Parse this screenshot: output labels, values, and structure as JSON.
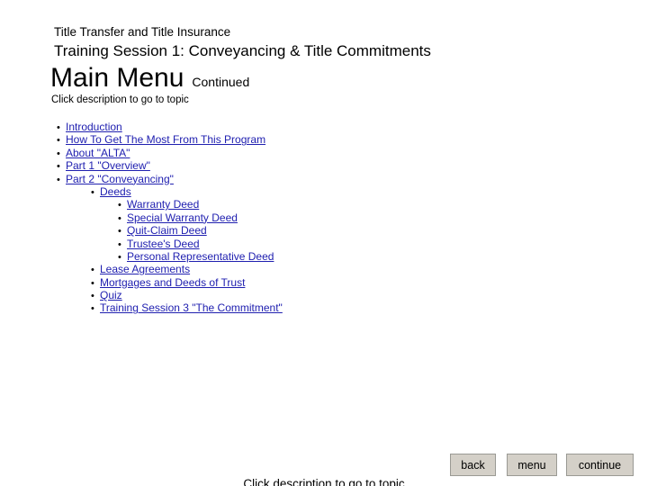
{
  "header": {
    "line1": "Title Transfer and Title Insurance",
    "line2": "Training Session 1: Conveyancing & Title Commitments"
  },
  "title": {
    "main": "Main Menu",
    "continued": "Continued"
  },
  "instruction": "Click description to go to topic",
  "menu": [
    {
      "label": "Introduction",
      "level": 1
    },
    {
      "label": " How To Get The Most From This Program",
      "level": 1
    },
    {
      "label": " About \"ALTA\"",
      "level": 1
    },
    {
      "label": " Part 1 \"Overview\"",
      "level": 1
    },
    {
      "label": " Part 2 \"Conveyancing\"",
      "level": 1
    },
    {
      "label": "Deeds",
      "level": 2
    },
    {
      "label": "Warranty Deed",
      "level": 3
    },
    {
      "label": "Special Warranty Deed",
      "level": 3
    },
    {
      "label": "Quit-Claim Deed",
      "level": 3
    },
    {
      "label": "Trustee's Deed",
      "level": 3
    },
    {
      "label": "Personal Representative Deed",
      "level": 3
    },
    {
      "label": " Lease Agreements",
      "level": 2
    },
    {
      "label": " Mortgages and Deeds of Trust",
      "level": 2
    },
    {
      "label": " Quiz",
      "level": 2
    },
    {
      "label": "Training Session 3 \"The Commitment\"",
      "level": 2
    }
  ],
  "nav": {
    "back": "back",
    "menu": "menu",
    "continue": "continue"
  },
  "footer": "Click description to go to topic",
  "colors": {
    "link": "#2020B0",
    "button_face": "#D4D0C8"
  }
}
